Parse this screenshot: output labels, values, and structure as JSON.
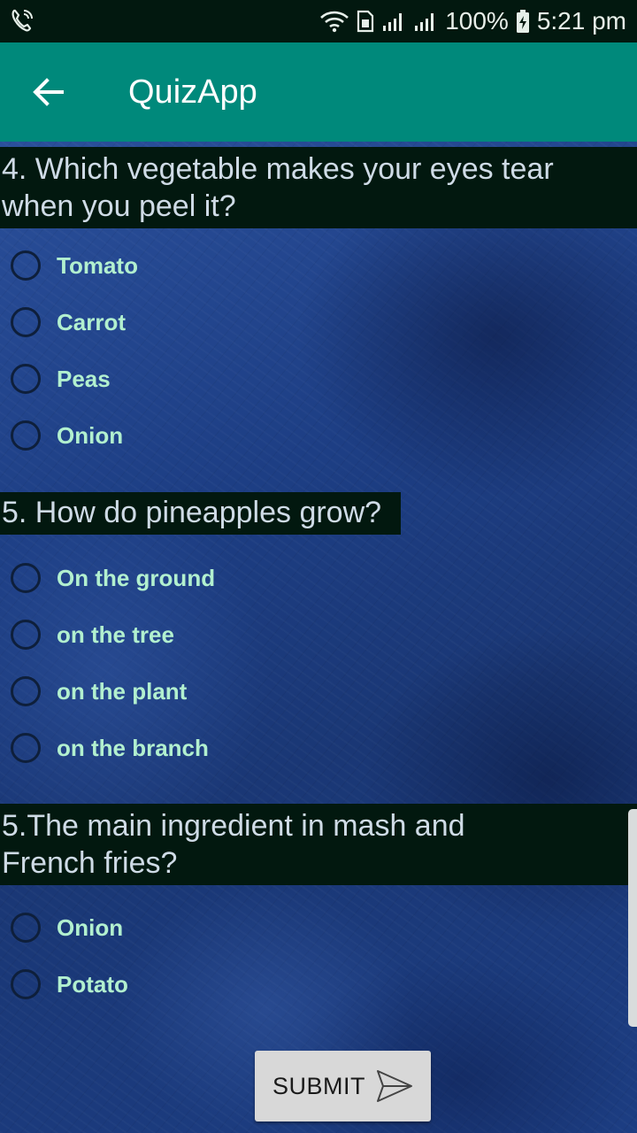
{
  "status_bar": {
    "battery": "100%",
    "time": "5:21 pm",
    "icons": [
      "wifi-call-icon",
      "wifi-icon",
      "sim-icon",
      "signal-icon",
      "signal-icon",
      "battery-charging-icon"
    ]
  },
  "app_bar": {
    "title": "QuizApp",
    "back_icon": "arrow-left-icon"
  },
  "questions": [
    {
      "text": "4. Which vegetable makes your eyes tear\nwhen you peel it?",
      "options": [
        "Tomato",
        "Carrot",
        "Peas",
        "Onion"
      ]
    },
    {
      "text": "5. How do pineapples grow?",
      "options": [
        "On the ground",
        "on the tree",
        "on the plant",
        "on the branch"
      ]
    },
    {
      "text": "5.The main ingredient in mash and\nFrench fries?",
      "options": [
        "Onion",
        "Potato"
      ]
    }
  ],
  "submit": {
    "label": "SUBMIT",
    "icon": "send-icon"
  },
  "colors": {
    "app_bar": "#00897b",
    "status_bar": "#02180f",
    "question_bg": "#02180f",
    "option_text": "#b2f0cf",
    "question_text": "#cfdbe6"
  }
}
